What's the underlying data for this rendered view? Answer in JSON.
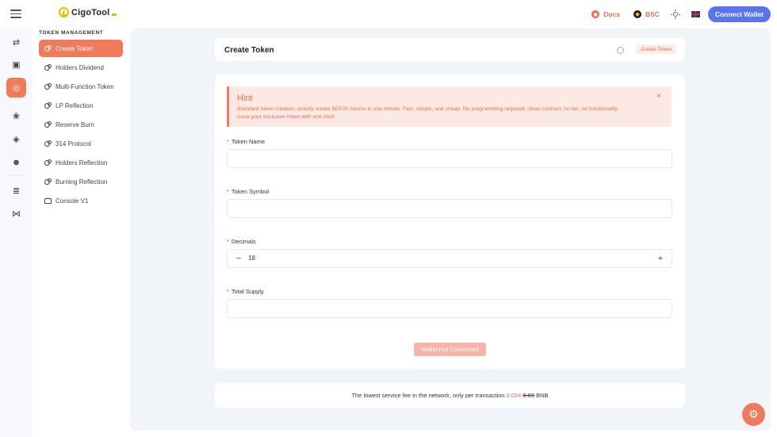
{
  "header": {
    "logo_text": "CigoTool",
    "docs_label": "Docs",
    "chain_label": "BSC",
    "connect_label": "Connect Wallet"
  },
  "rail": {
    "icons": [
      "swap-icon",
      "wallet-icon",
      "token-icon",
      "rabbit-icon",
      "binance-icon",
      "panda-icon",
      "database-icon",
      "butterfly-icon"
    ],
    "active_index": 2
  },
  "sidebar": {
    "heading": "TOKEN MANAGEMENT",
    "items": [
      {
        "label": "Create Token",
        "icon": "coins-icon",
        "active": true
      },
      {
        "label": "Holders Dividend",
        "icon": "coins-icon",
        "active": false
      },
      {
        "label": "Multi-Function Token",
        "icon": "coins-icon",
        "active": false
      },
      {
        "label": "LP Reflection",
        "icon": "coins-icon",
        "active": false
      },
      {
        "label": "Reserve Burn",
        "icon": "coins-icon",
        "active": false
      },
      {
        "label": "314 Protocol",
        "icon": "coins-icon",
        "active": false
      },
      {
        "label": "Holders Reflection",
        "icon": "coins-icon",
        "active": false
      },
      {
        "label": "Burning Reflection",
        "icon": "coins-icon",
        "active": false
      },
      {
        "label": "Console V1",
        "icon": "console-icon",
        "active": false
      }
    ]
  },
  "page": {
    "title": "Create Token",
    "breadcrumb": "Create Token"
  },
  "hint": {
    "title": "Hint",
    "text": "Standard token creation, quickly create BEP20 tokens in one minute. Fast, simple, and cheap. No programming required, clean contract, no tax, no functionality, issue your exclusive token with one click!"
  },
  "form": {
    "required_mark": "*",
    "token_name_label": "Token Name",
    "token_name_value": "",
    "token_symbol_label": "Token Symbol",
    "token_symbol_value": "",
    "decimals_label": "Decimals",
    "decimals_value": "18",
    "minus_label": "−",
    "plus_label": "+",
    "total_supply_label": "Total Supply",
    "total_supply_value": "",
    "submit_label": "Wallet Not Connected"
  },
  "fee": {
    "prefix": "The lowest service fee in the network, only per transaction",
    "new_price": "0.024",
    "old_price": "0.03",
    "unit": "BNB"
  },
  "colors": {
    "accent": "#f07a5c",
    "connect": "#5a73f3",
    "background": "#f1f4f9"
  }
}
